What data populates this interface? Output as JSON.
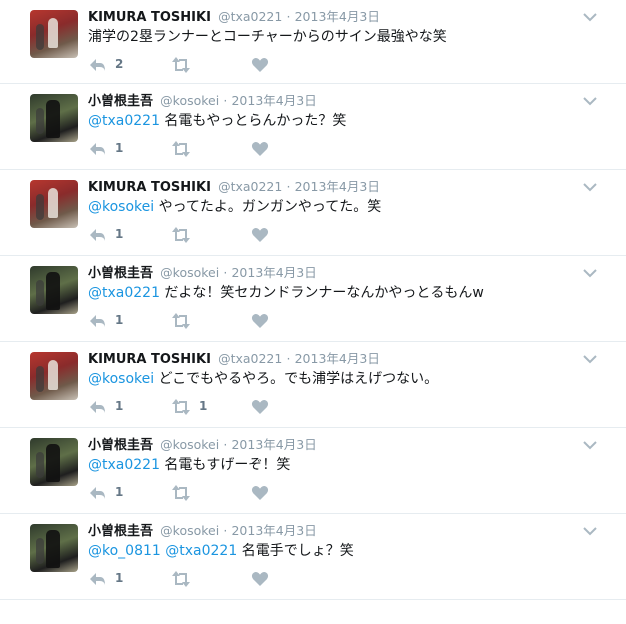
{
  "tweets": [
    {
      "name": "KIMURA TOSHIKI",
      "handle": "@txa0221",
      "date": "2013年4月3日",
      "avatar": "kimura",
      "mention": "",
      "body": "浦学の2塁ランナーとコーチャーからのサイン最強やな笑",
      "replies": "2",
      "retweets": ""
    },
    {
      "name": "小曽根圭吾",
      "handle": "@kosokei",
      "date": "2013年4月3日",
      "avatar": "kosokei",
      "mention": "@txa0221",
      "body": " 名電もやっとらんかった？笑",
      "replies": "1",
      "retweets": ""
    },
    {
      "name": "KIMURA TOSHIKI",
      "handle": "@txa0221",
      "date": "2013年4月3日",
      "avatar": "kimura",
      "mention": "@kosokei",
      "body": " やってたよ。ガンガンやってた。笑",
      "replies": "1",
      "retweets": ""
    },
    {
      "name": "小曽根圭吾",
      "handle": "@kosokei",
      "date": "2013年4月3日",
      "avatar": "kosokei",
      "mention": "@txa0221",
      "body": " だよな！笑セカンドランナーなんかやっとるもんw",
      "replies": "1",
      "retweets": ""
    },
    {
      "name": "KIMURA TOSHIKI",
      "handle": "@txa0221",
      "date": "2013年4月3日",
      "avatar": "kimura",
      "mention": "@kosokei",
      "body": " どこでもやるやろ。でも浦学はえげつない。",
      "replies": "1",
      "retweets": "1"
    },
    {
      "name": "小曽根圭吾",
      "handle": "@kosokei",
      "date": "2013年4月3日",
      "avatar": "kosokei",
      "mention": "@txa0221",
      "body": " 名電もすげーぞ！笑",
      "replies": "1",
      "retweets": ""
    },
    {
      "name": "小曽根圭吾",
      "handle": "@kosokei",
      "date": "2013年4月3日",
      "avatar": "kosokei",
      "mention": "@ko_0811 @txa0221",
      "body": " 名電手でしょ？笑",
      "replies": "1",
      "retweets": ""
    }
  ],
  "separator": "·",
  "icons": {
    "reply": "reply-icon",
    "retweet": "retweet-icon",
    "like": "heart-icon",
    "more": "chevron-down-icon"
  },
  "colors": {
    "link": "#1b95e0",
    "muted": "#8899a6",
    "icon": "#aab8c2",
    "border": "#e6ecf0"
  }
}
